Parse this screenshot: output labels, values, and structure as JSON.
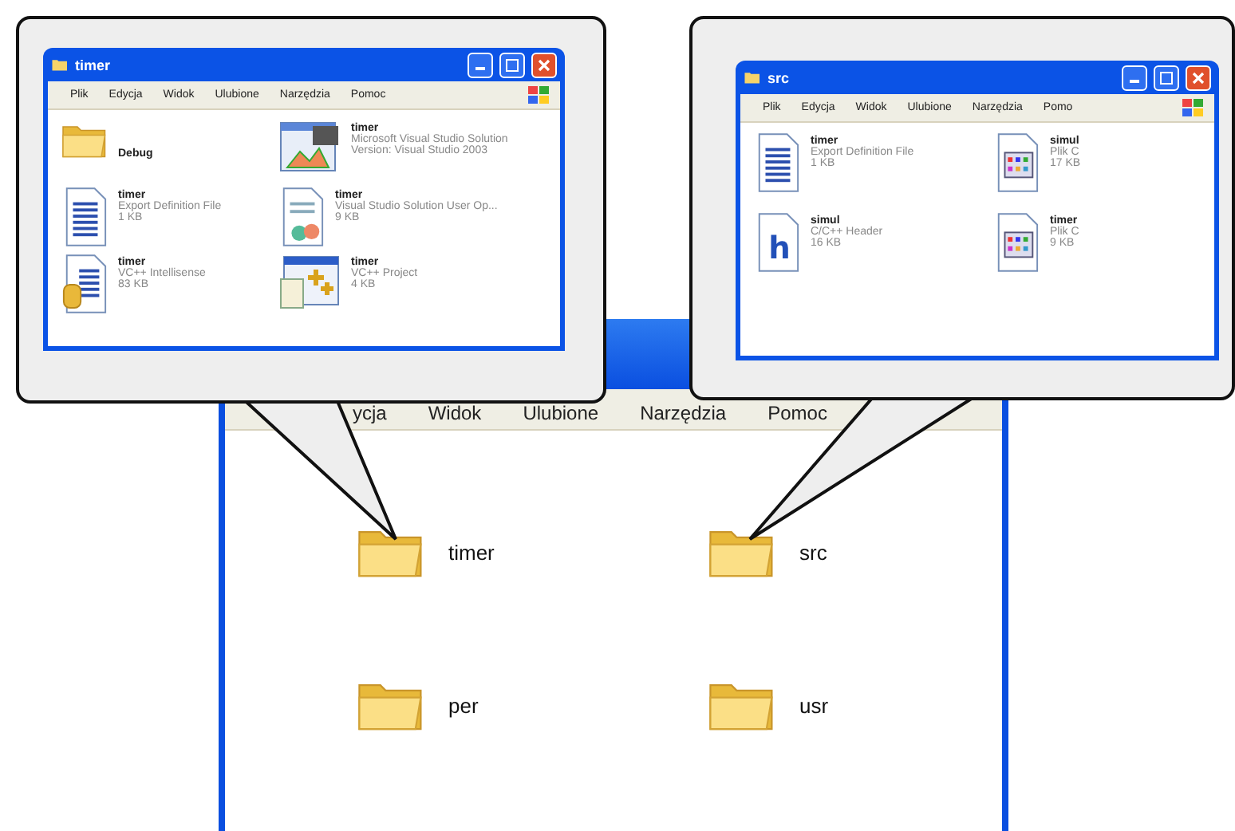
{
  "main_window": {
    "menu": [
      "ycja",
      "Widok",
      "Ulubione",
      "Narzędzia",
      "Pomoc"
    ],
    "folders": [
      {
        "name": "timer"
      },
      {
        "name": "src"
      },
      {
        "name": "per"
      },
      {
        "name": "usr"
      }
    ]
  },
  "callouts": [
    {
      "window": {
        "title": "timer",
        "menu": [
          "Plik",
          "Edycja",
          "Widok",
          "Ulubione",
          "Narzędzia",
          "Pomoc"
        ],
        "files": [
          {
            "kind": "folder",
            "name": "Debug"
          },
          {
            "kind": "solution",
            "name": "timer",
            "type": "Microsoft Visual Studio Solution",
            "size": "Version: Visual Studio 2003"
          },
          {
            "kind": "def",
            "name": "timer",
            "type": "Export Definition File",
            "size": "1 KB"
          },
          {
            "kind": "suo",
            "name": "timer",
            "type": "Visual Studio Solution User Op...",
            "size": "9 KB"
          },
          {
            "kind": "ncb",
            "name": "timer",
            "type": "VC++ Intellisense",
            "size": "83 KB"
          },
          {
            "kind": "vcproj",
            "name": "timer",
            "type": "VC++ Project",
            "size": "4 KB"
          }
        ]
      }
    },
    {
      "window": {
        "title": "src",
        "menu": [
          "Plik",
          "Edycja",
          "Widok",
          "Ulubione",
          "Narzędzia",
          "Pomo"
        ],
        "files": [
          {
            "kind": "def",
            "name": "timer",
            "type": "Export Definition File",
            "size": "1 KB"
          },
          {
            "kind": "c",
            "name": "simul",
            "type": "Plik C",
            "size": "17 KB"
          },
          {
            "kind": "h",
            "name": "simul",
            "type": "C/C++ Header",
            "size": "16 KB"
          },
          {
            "kind": "c",
            "name": "timer",
            "type": "Plik C",
            "size": "9 KB"
          }
        ]
      }
    }
  ]
}
